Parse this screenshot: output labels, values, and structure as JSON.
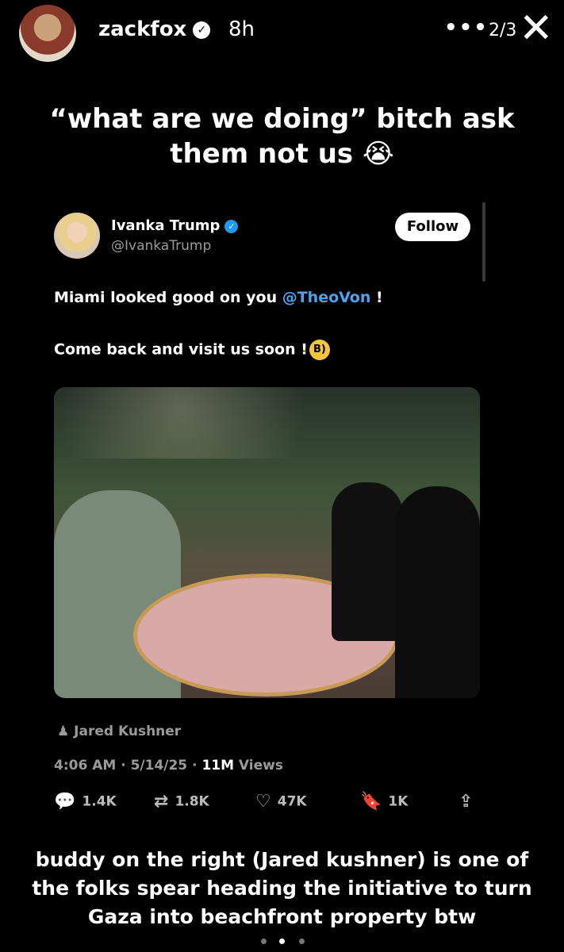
{
  "header": {
    "username": "zackfox",
    "age": "8h",
    "more_label": "•••",
    "pager": "2/3",
    "close_label": "✕"
  },
  "caption_top": "“what are we doing” bitch ask them not us 😭",
  "tweet": {
    "name": "Ivanka Trump",
    "handle": "@IvankaTrump",
    "follow_label": "Follow",
    "line1_before": "Miami looked good on you ",
    "line1_mention": "@TheoVon",
    "line1_after": " !",
    "line2": "Come back and visit us soon !",
    "tag": "Jared Kushner",
    "time": "4:06 AM · 5/14/25 · ",
    "views_count": "11M",
    "views_label": " Views",
    "replies": "1.4K",
    "reposts": "1.8K",
    "likes": "47K",
    "bookmarks": "1K"
  },
  "caption_bottom": "buddy on the right (Jared kushner) is one of the folks spear heading the initiative to turn Gaza into beachfront property btw",
  "colors": {
    "mention": "#4aa3f0",
    "verified": "#1d9bf0"
  }
}
